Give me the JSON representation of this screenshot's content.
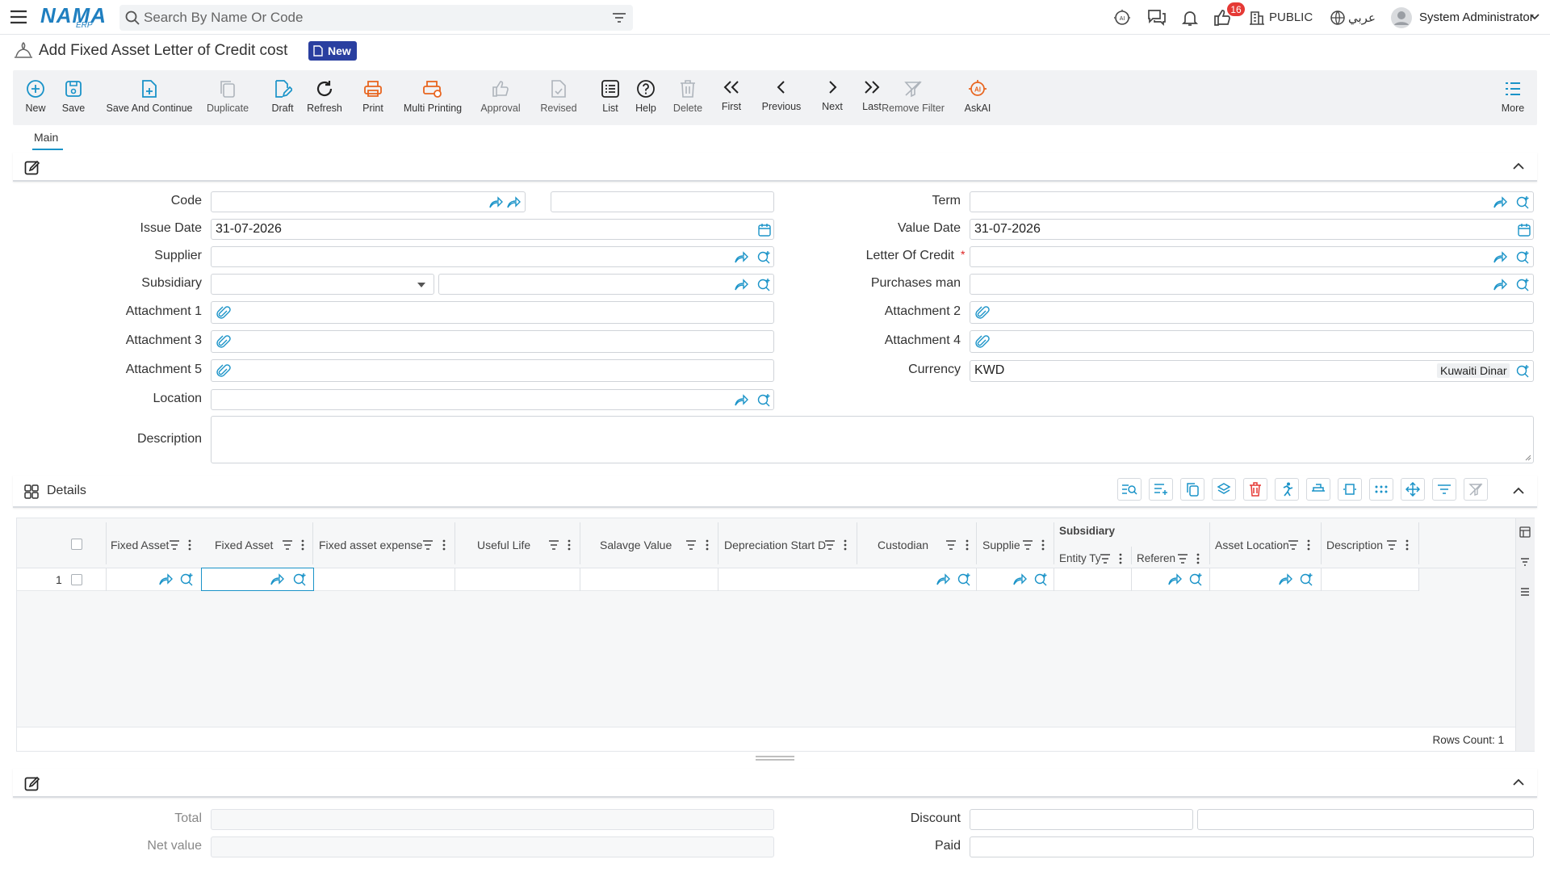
{
  "header": {
    "logo_text": "NAMA",
    "logo_sub": "ERP",
    "search_placeholder": "Search By Name Or Code",
    "notification_count": "16",
    "branch": "PUBLIC",
    "language": "عربي",
    "user": "System Administrator"
  },
  "page": {
    "title": "Add Fixed Asset Letter of Credit cost",
    "badge": "New"
  },
  "toolbar": [
    {
      "name": "new",
      "label": "New",
      "icon": "plus-circle-icon"
    },
    {
      "name": "save",
      "label": "Save",
      "icon": "save-icon"
    },
    {
      "name": "save-and-continue",
      "label": "Save And Continue",
      "icon": "file-plus-icon"
    },
    {
      "name": "duplicate",
      "label": "Duplicate",
      "icon": "copy-icon"
    },
    {
      "name": "draft",
      "label": "Draft",
      "icon": "edit-doc-icon"
    },
    {
      "name": "refresh",
      "label": "Refresh",
      "icon": "refresh-icon"
    },
    {
      "name": "print",
      "label": "Print",
      "icon": "print-icon"
    },
    {
      "name": "multi-printing",
      "label": "Multi Printing",
      "icon": "multi-print-icon"
    },
    {
      "name": "approval",
      "label": "Approval",
      "icon": "thumbs-up-icon"
    },
    {
      "name": "revised",
      "label": "Revised",
      "icon": "revised-doc-icon"
    },
    {
      "name": "list",
      "label": "List",
      "icon": "list-icon"
    },
    {
      "name": "help",
      "label": "Help",
      "icon": "help-icon"
    },
    {
      "name": "delete",
      "label": "Delete",
      "icon": "trash-icon"
    },
    {
      "name": "first",
      "label": "First",
      "icon": "double-chevron-left-icon"
    },
    {
      "name": "previous",
      "label": "Previous",
      "icon": "chevron-left-icon"
    },
    {
      "name": "next",
      "label": "Next",
      "icon": "chevron-right-icon"
    },
    {
      "name": "last",
      "label": "Last",
      "icon": "double-chevron-right-icon"
    },
    {
      "name": "remove-filter",
      "label": "Remove Filter",
      "icon": "filter-off-icon"
    },
    {
      "name": "askai",
      "label": "AskAI",
      "icon": "ai-icon"
    },
    {
      "name": "more",
      "label": "More",
      "icon": "more-list-icon"
    }
  ],
  "tabs": {
    "main": "Main"
  },
  "form": {
    "code": "Code",
    "issue_date_label": "Issue Date",
    "issue_date": "31-07-2026",
    "supplier": "Supplier",
    "subsidiary": "Subsidiary",
    "attachment1": "Attachment 1",
    "attachment3": "Attachment 3",
    "attachment5": "Attachment 5",
    "location": "Location",
    "description": "Description",
    "term": "Term",
    "value_date_label": "Value Date",
    "value_date": "31-07-2026",
    "letter_of_credit": "Letter Of Credit",
    "required_mark": "*",
    "purchases_man": "Purchases man",
    "attachment2": "Attachment 2",
    "attachment4": "Attachment 4",
    "currency_label": "Currency",
    "currency_code": "KWD",
    "currency_name": "Kuwaiti Dinar"
  },
  "details": {
    "title": "Details",
    "columns": {
      "fixed_asset_cat": "Fixed Asset",
      "fixed_asset": "Fixed Asset",
      "expense": "Fixed asset expense",
      "useful_life": "Useful Life",
      "salvage": "Salavge Value",
      "dep_start": "Depreciation Start D",
      "custodian": "Custodian",
      "supplier": "Supplie",
      "subsidiary_group": "Subsidiary",
      "entity_type": "Entity Ty",
      "reference": "Referen",
      "asset_location": "Asset Location",
      "description": "Description"
    },
    "row_number": "1",
    "rows_count": "Rows Count: 1"
  },
  "footer": {
    "total": "Total",
    "net_value": "Net value",
    "discount": "Discount",
    "paid": "Paid"
  },
  "colors": {
    "accent": "#1a93c8",
    "badge": "#2a3fa0",
    "print": "#e8641e",
    "notify": "#e53935"
  }
}
